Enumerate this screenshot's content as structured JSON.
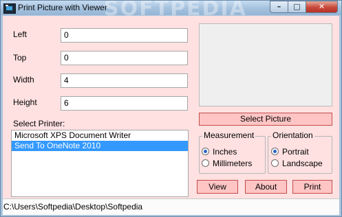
{
  "window": {
    "title": "Print Picture with Viewer",
    "watermark": "SOFTPEDIA",
    "controls": {
      "minimize": "–",
      "maximize": "□",
      "close": "✕"
    }
  },
  "form": {
    "left": {
      "label": "Left",
      "value": "0"
    },
    "top": {
      "label": "Top",
      "value": "0"
    },
    "width": {
      "label": "Width",
      "value": "4"
    },
    "height": {
      "label": "Height",
      "value": "6"
    }
  },
  "printer": {
    "label": "Select Printer:",
    "items": [
      "Microsoft XPS Document Writer",
      "Send To OneNote 2010"
    ],
    "selected_index": 1
  },
  "preview": {
    "select_button": "Select Picture"
  },
  "measurement": {
    "title": "Measurement",
    "options": [
      "Inches",
      "Millimeters"
    ],
    "selected": "Inches"
  },
  "orientation": {
    "title": "Orientation",
    "options": [
      "Portrait",
      "Landscape"
    ],
    "selected": "Portrait"
  },
  "buttons": {
    "view": "View",
    "about": "About",
    "print": "Print"
  },
  "status": {
    "path": "C:\\Users\\Softpedia\\Desktop\\Softpedia"
  },
  "colors": {
    "client_bg": "#ffe1e1",
    "button_bg": "#ffc5c5",
    "button_border": "#c44a4a",
    "selection": "#3399ff"
  },
  "icons": {
    "app": "app-icon"
  }
}
